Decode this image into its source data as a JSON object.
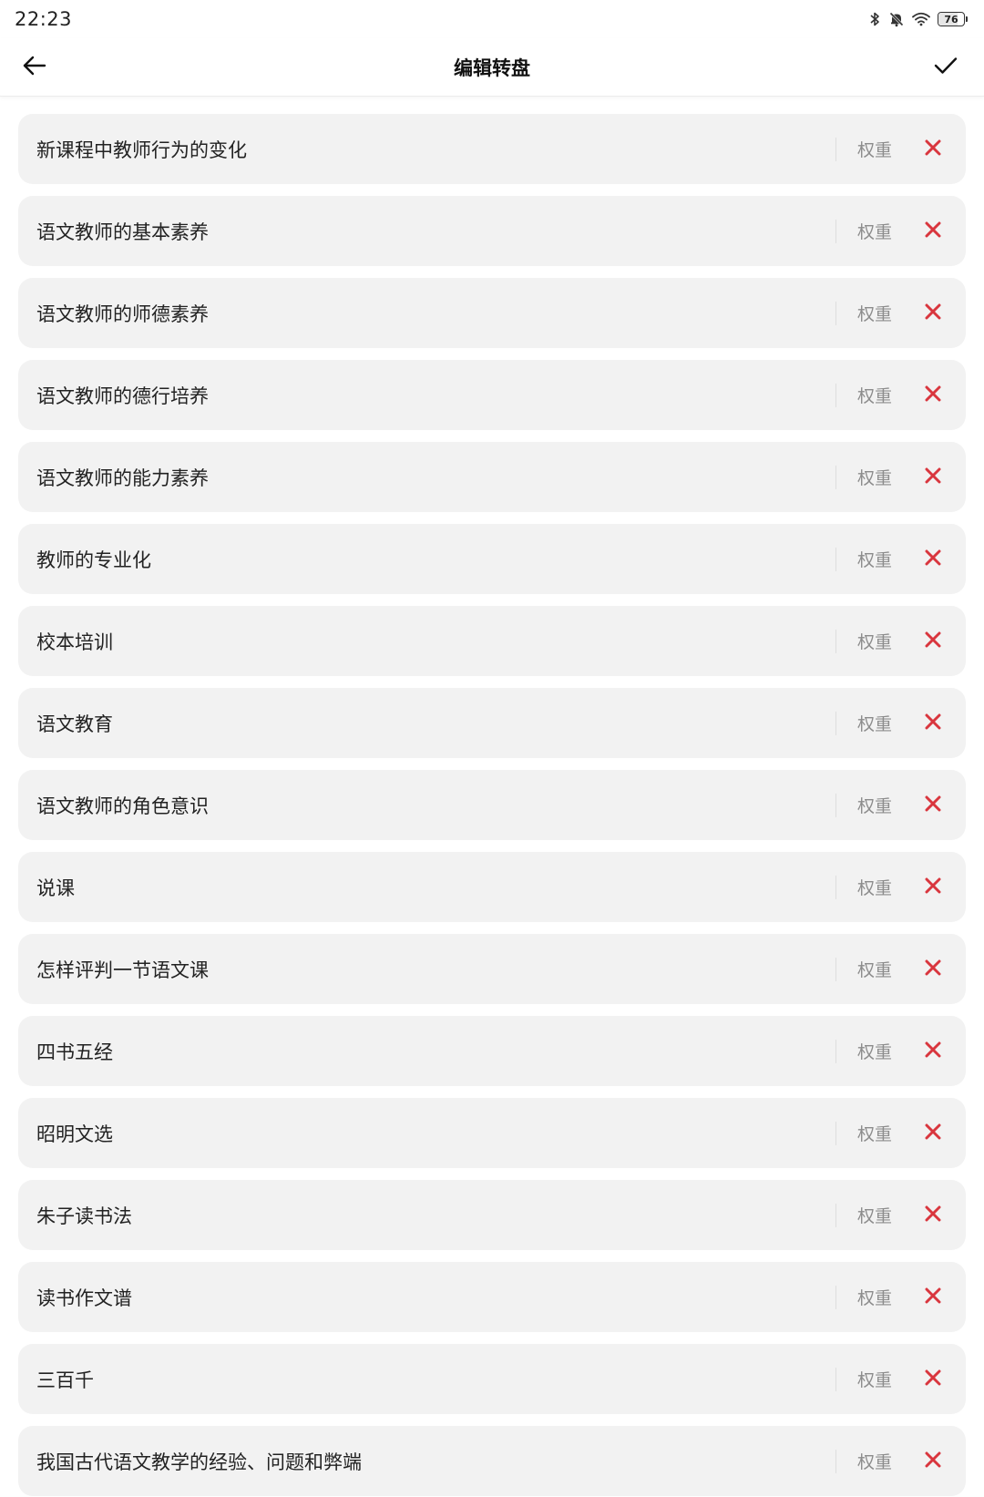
{
  "status_bar": {
    "time": "22:23",
    "battery_level": "76",
    "icons": [
      "bluetooth-icon",
      "bell-muted-icon",
      "wifi-icon",
      "battery-icon"
    ]
  },
  "header": {
    "title": "编辑转盘",
    "back_icon": "arrow-left-icon",
    "confirm_icon": "checkmark-icon"
  },
  "colors": {
    "delete": "#d9363e",
    "row_bg": "#f2f2f2",
    "weight_text": "#8c8c8c"
  },
  "weight_label": "权重",
  "items": [
    {
      "name": "新课程中教师行为的变化"
    },
    {
      "name": "语文教师的基本素养"
    },
    {
      "name": "语文教师的师德素养"
    },
    {
      "name": "语文教师的德行培养"
    },
    {
      "name": "语文教师的能力素养"
    },
    {
      "name": "教师的专业化"
    },
    {
      "name": "校本培训"
    },
    {
      "name": "语文教育"
    },
    {
      "name": "语文教师的角色意识"
    },
    {
      "name": "说课"
    },
    {
      "name": "怎样评判一节语文课"
    },
    {
      "name": "四书五经"
    },
    {
      "name": "昭明文选"
    },
    {
      "name": "朱子读书法"
    },
    {
      "name": "读书作文谱"
    },
    {
      "name": "三百千"
    },
    {
      "name": "我国古代语文教学的经验、问题和弊端"
    }
  ]
}
